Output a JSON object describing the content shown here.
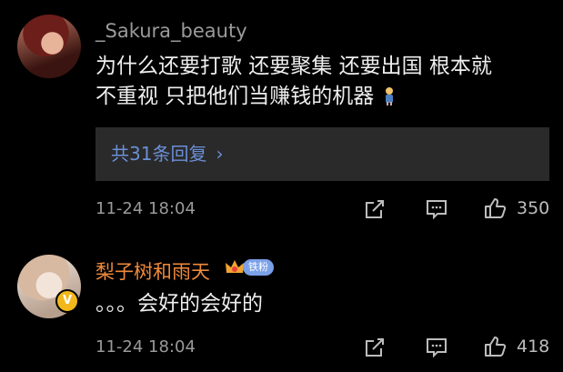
{
  "comments": [
    {
      "username": "_Sakura_beauty",
      "text_line1": "为什么还要打歌 还要聚集 还要出国 根本就",
      "text_line2": "不重视 只把他们当赚钱的机器",
      "emoji": "disappointed-emoji",
      "replies_label": "共31条回复",
      "timestamp": "11-24 18:04",
      "likes": "350"
    },
    {
      "username": "梨子树和雨天",
      "fan_badge": "铁粉",
      "text": "。。。会好的会好的",
      "timestamp": "11-24 18:04",
      "likes": "418"
    }
  ],
  "colors": {
    "background": "#000000",
    "username_gray": "#9a9a9a",
    "username_orange": "#f08a3a",
    "reply_link": "#6b8fd6",
    "reply_box": "#2a2a2a"
  }
}
